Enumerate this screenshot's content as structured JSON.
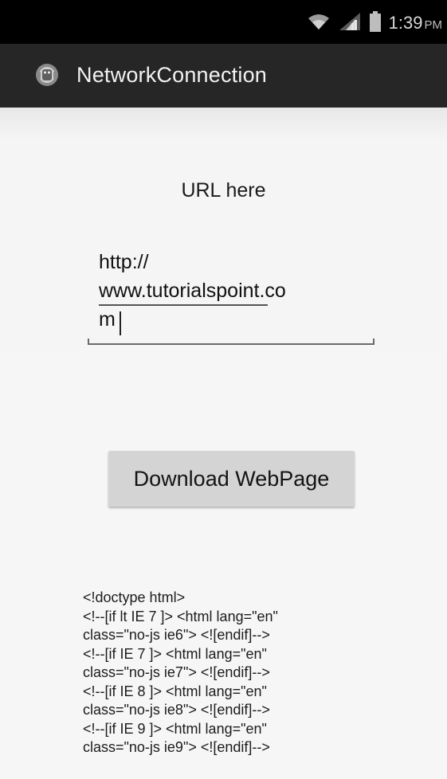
{
  "status_bar": {
    "time": "1:39",
    "ampm": "PM",
    "icons": [
      "wifi-icon",
      "signal-icon",
      "battery-icon"
    ]
  },
  "action_bar": {
    "app_icon": "android-icon",
    "title": "NetworkConnection"
  },
  "main": {
    "url_label": "URL here",
    "url_value": "http://\nwww.tutorialspoint.co\nm",
    "download_button": "Download WebPage",
    "result_lines": [
      "<!doctype html>",
      "<!--[if lt IE 7 ]> <html lang=\"en\"",
      "class=\"no-js ie6\"> <![endif]-->",
      "<!--[if IE 7 ]> <html lang=\"en\"",
      "class=\"no-js ie7\"> <![endif]-->",
      "<!--[if IE 8 ]> <html lang=\"en\"",
      "class=\"no-js ie8\"> <![endif]-->",
      "<!--[if IE 9 ]> <html lang=\"en\"",
      "class=\"no-js ie9\"> <![endif]-->"
    ]
  },
  "colors": {
    "status_bar": "#000000",
    "action_bar": "#262626",
    "background": "#f3f3f3",
    "button": "#d4d4d4"
  }
}
